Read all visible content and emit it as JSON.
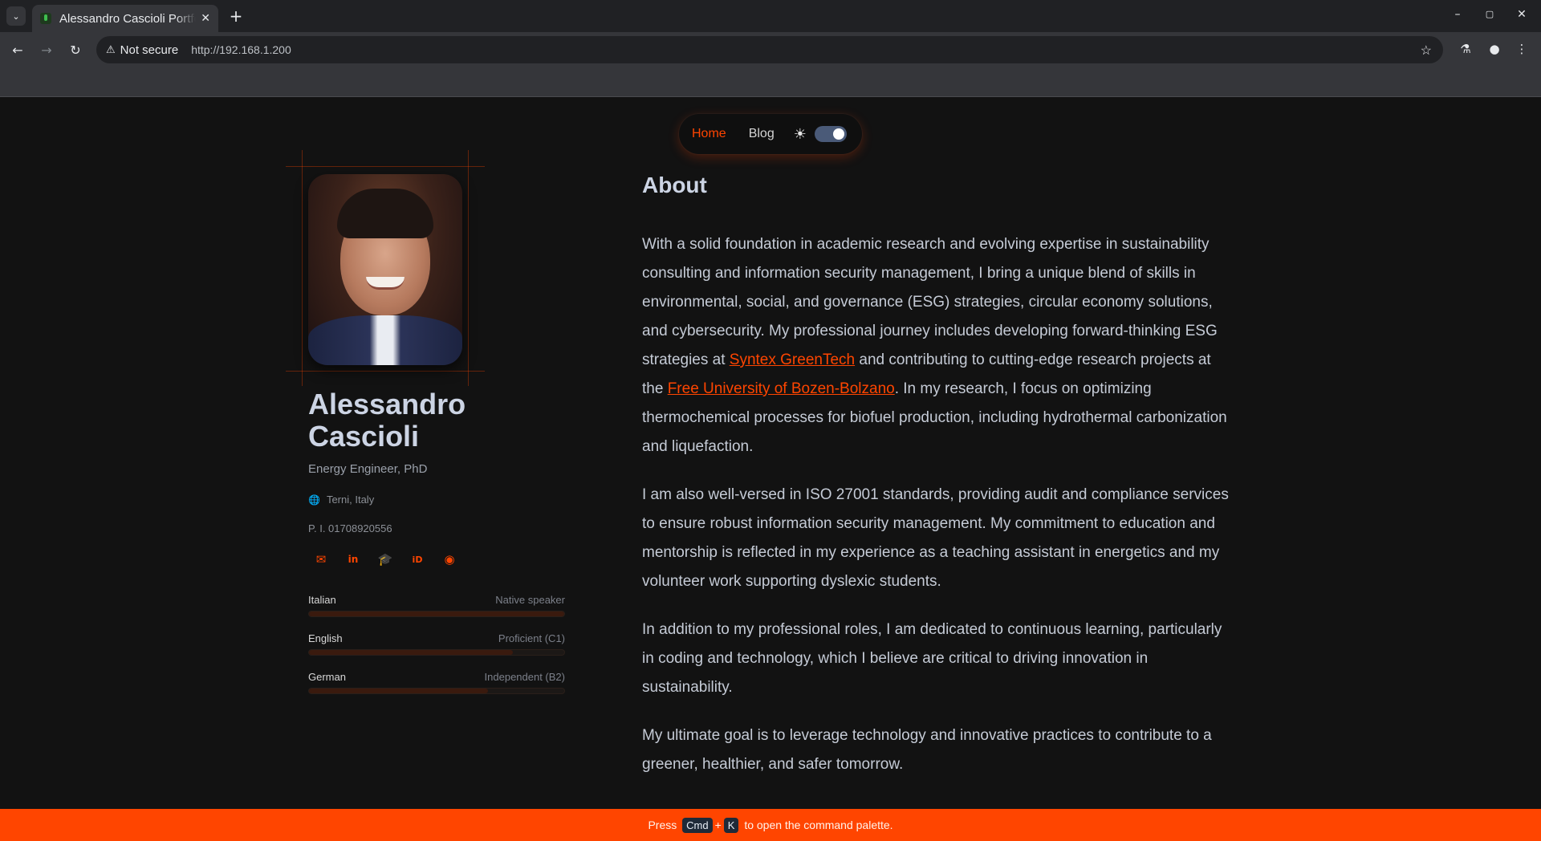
{
  "browser": {
    "tab_title": "Alessandro Cascioli Portfolio",
    "security_label": "Not secure",
    "url": "http://192.168.1.200"
  },
  "nav": {
    "home": "Home",
    "blog": "Blog",
    "theme_toggle_on": true
  },
  "profile": {
    "name": "Alessandro Cascioli",
    "role": "Energy Engineer, PhD",
    "location": "Terni, Italy",
    "vat": "P. I. 01708920556",
    "socials": [
      "mail-icon",
      "linkedin-icon",
      "graduation-cap-icon",
      "orcid-icon",
      "github-icon"
    ]
  },
  "languages": [
    {
      "name": "Italian",
      "level": "Native speaker",
      "proficiency": 1.0
    },
    {
      "name": "English",
      "level": "Proficient (C1)",
      "proficiency": 0.8
    },
    {
      "name": "German",
      "level": "Independent (B2)",
      "proficiency": 0.7
    }
  ],
  "about": {
    "title": "About",
    "p1_before": "With a solid foundation in academic research and evolving expertise in sustainability consulting and information security management, I bring a unique blend of skills in environmental, social, and governance (ESG) strategies, circular economy solutions, and cybersecurity. My professional journey includes developing forward-thinking ESG strategies at ",
    "p1_link1": "Syntex GreenTech",
    "p1_middle": " and contributing to cutting-edge research projects at the ",
    "p1_link2": "Free University of Bozen-Bolzano",
    "p1_after": ". In my research, I focus on optimizing thermochemical processes for biofuel production, including hydrothermal carbonization and liquefaction.",
    "p2": "I am also well-versed in ISO 27001 standards, providing audit and compliance services to ensure robust information security management. My commitment to education and mentorship is reflected in my experience as a teaching assistant in energetics and my volunteer work supporting dyslexic students.",
    "p3": "In addition to my professional roles, I am dedicated to continuous learning, particularly in coding and technology, which I believe are critical to driving innovation in sustainability.",
    "p4": "My ultimate goal is to leverage technology and innovative practices to contribute to a greener, healthier, and safer tomorrow."
  },
  "command_bar": {
    "press": "Press",
    "key1": "Cmd",
    "plus": "+",
    "key2": "K",
    "rest": "to open the command palette."
  },
  "colors": {
    "accent": "#ff4500",
    "background": "#121212"
  }
}
